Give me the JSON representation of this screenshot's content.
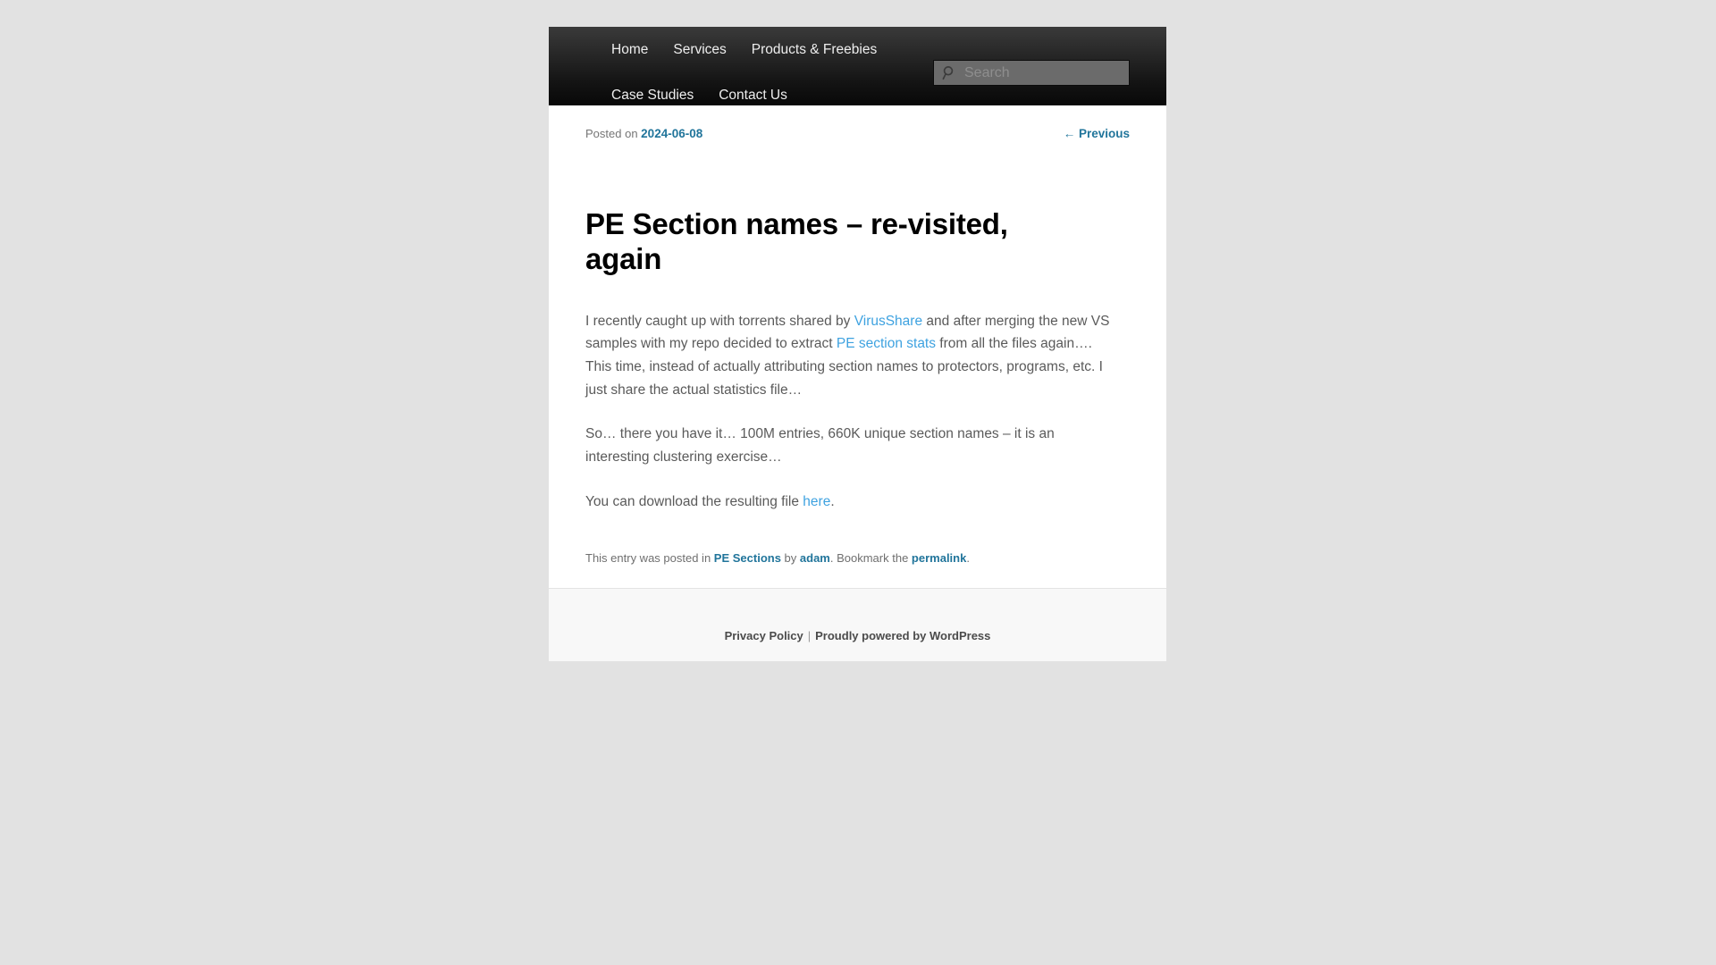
{
  "header": {
    "nav_row1": [
      {
        "label": "Home"
      },
      {
        "label": "Services"
      },
      {
        "label": "Products & Freebies"
      }
    ],
    "nav_row2": [
      {
        "label": "Case Studies"
      },
      {
        "label": "Contact Us"
      }
    ],
    "search": {
      "placeholder": "Search",
      "value": "",
      "icon": "search-icon"
    }
  },
  "post": {
    "posted_label": "Posted on",
    "date": "2024-06-08",
    "prev_link": "← Previous",
    "title": "PE Section names – re-visited, again",
    "paragraphs": [
      {
        "parts": [
          {
            "type": "text",
            "text": "I recently caught up with torrents shared by "
          },
          {
            "type": "link",
            "text": "VirusShare"
          },
          {
            "type": "text",
            "text": " and after merging the new VS samples with my repo decided to extract "
          },
          {
            "type": "link",
            "text": "PE section stats"
          },
          {
            "type": "text",
            "text": " from all the files again…. This time, instead of actually attributing section names to protectors, programs, etc. I just share the actual statistics file…"
          }
        ]
      },
      {
        "parts": [
          {
            "type": "text",
            "text": "So… there you have it… 100M entries, 660K unique section names – it is an interesting clustering exercise…"
          }
        ]
      },
      {
        "parts": [
          {
            "type": "text",
            "text": "You can download the resulting file "
          },
          {
            "type": "link",
            "text": "here"
          },
          {
            "type": "text",
            "text": "."
          }
        ]
      }
    ],
    "meta": {
      "prefix": "This entry was posted in ",
      "category": "PE Sections",
      "by": " by ",
      "author": "adam",
      "middle": ". Bookmark the ",
      "permalink": "permalink",
      "suffix": "."
    }
  },
  "footer": {
    "privacy_label": "Privacy Policy",
    "separator": "|",
    "powered_label": "Proudly powered by WordPress"
  },
  "colors": {
    "page_background": "#e2e2e2",
    "content_background": "#ffffff",
    "masthead_dark": "#141414",
    "link_blue": "#21759b",
    "content_link_blue": "#3ea2e0",
    "body_text": "#5a5a5a",
    "footer_background": "#f8f8f8"
  }
}
